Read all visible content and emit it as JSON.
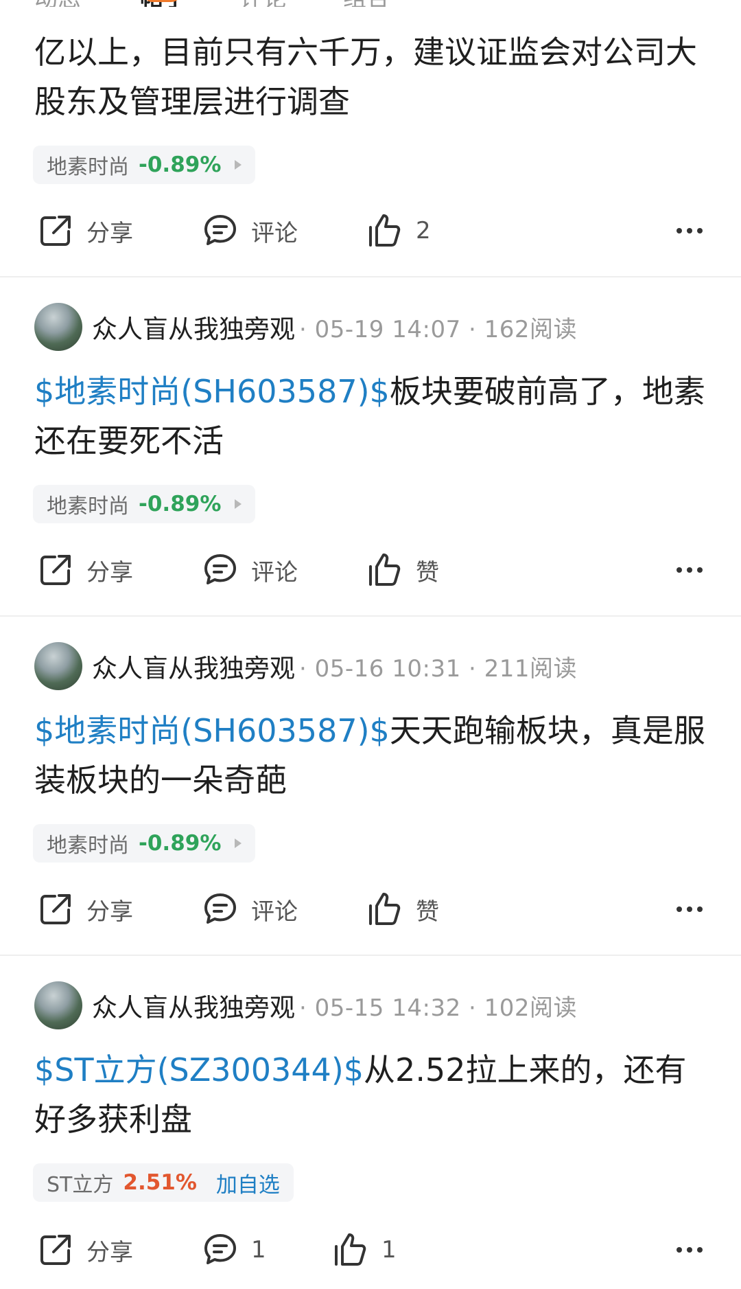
{
  "top_tabs": [
    "动态",
    "帖子",
    "评论",
    "组合"
  ],
  "posts": [
    {
      "content_text": "亿以上，目前只有六千万，建议证监会对公司大股东及管理层进行调查",
      "stock_tag": {
        "name": "地素时尚",
        "change": "-0.89%"
      },
      "actions": {
        "share": "分享",
        "comment": "评论",
        "like": "2"
      }
    },
    {
      "username": "众人盲从我独旁观",
      "meta": "· 05-19 14:07 · 162阅读",
      "stock_link": "$地素时尚(SH603587)$",
      "content_text": "板块要破前高了，地素还在要死不活",
      "stock_tag": {
        "name": "地素时尚",
        "change": "-0.89%"
      },
      "actions": {
        "share": "分享",
        "comment": "评论",
        "like": "赞"
      }
    },
    {
      "username": "众人盲从我独旁观",
      "meta": "· 05-16 10:31 · 211阅读",
      "stock_link": "$地素时尚(SH603587)$",
      "content_text": "天天跑输板块，真是服装板块的一朵奇葩",
      "stock_tag": {
        "name": "地素时尚",
        "change": "-0.89%"
      },
      "actions": {
        "share": "分享",
        "comment": "评论",
        "like": "赞"
      }
    },
    {
      "username": "众人盲从我独旁观",
      "meta": "· 05-15 14:32 · 102阅读",
      "stock_link": "$ST立方(SZ300344)$",
      "content_text": "从2.52拉上来的，还有好多获利盘",
      "stock_tag": {
        "name": "ST立方",
        "change": "2.51%",
        "follow": "加自选"
      },
      "actions": {
        "share": "分享",
        "comment": "1",
        "like": "1"
      }
    }
  ],
  "colors": {
    "link": "#1f7fc4",
    "down": "#2fa35a",
    "up": "#e2572f",
    "tab_accent": "#f07a2b"
  },
  "icons": [
    "share-icon",
    "comment-icon",
    "thumbs-up-icon",
    "more-icon"
  ]
}
